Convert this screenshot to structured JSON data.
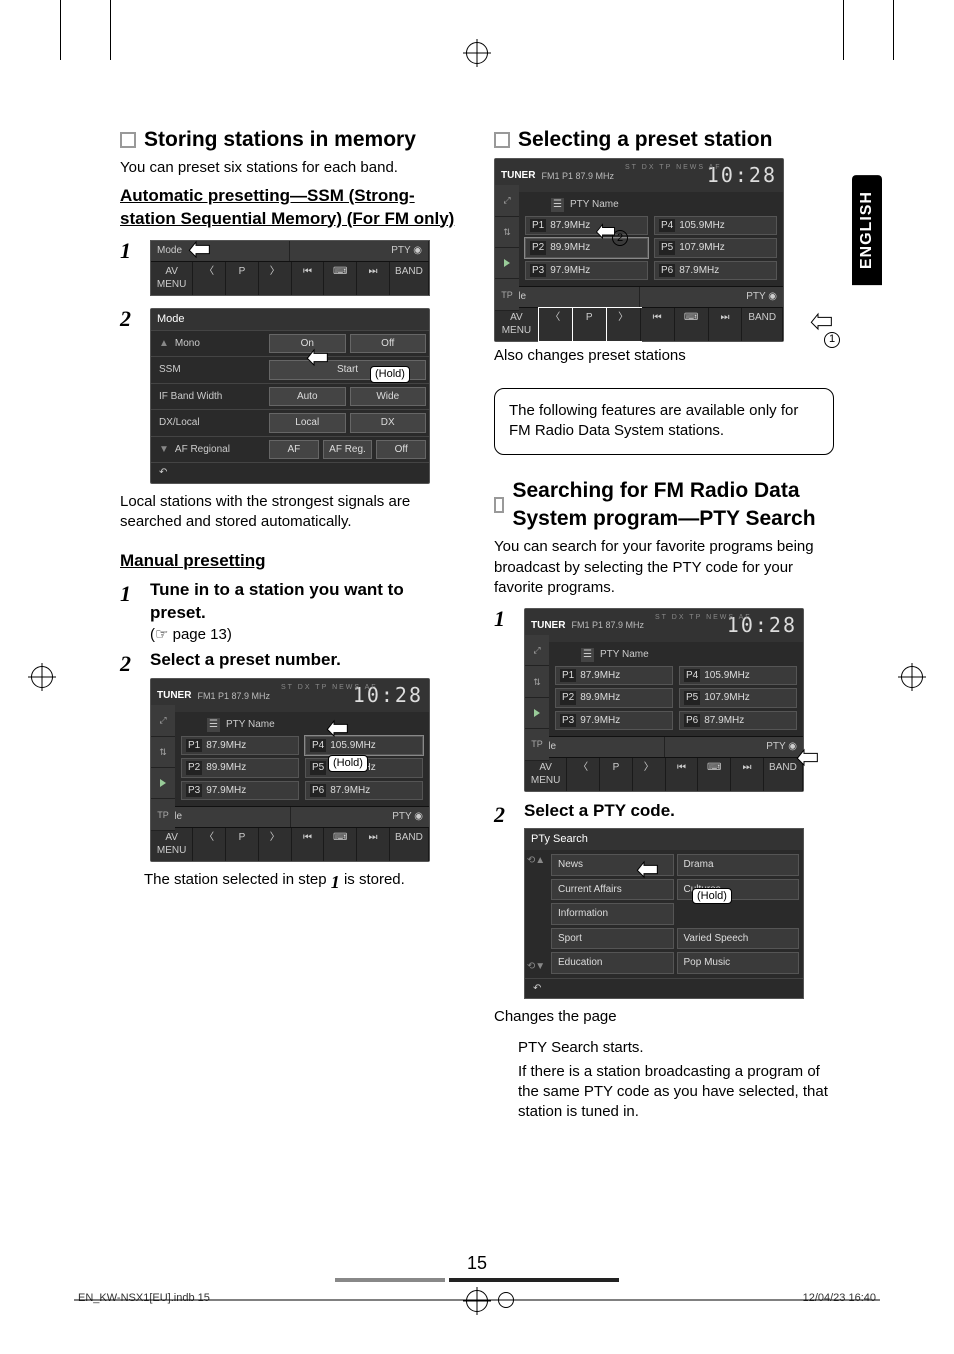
{
  "english_tab": "ENGLISH",
  "page_number": "15",
  "footer_left": "EN_KW-NSX1[EU].indb   15",
  "footer_right": "12/04/23   16:40",
  "left": {
    "h_store": "Storing stations in memory",
    "preset_line": "You can preset six stations for each band.",
    "auto_heading": "Automatic presetting—SSM (Strong-station Sequential Memory) (For FM only)",
    "step1": "1",
    "step2": "2",
    "bar_shot": {
      "mode": "Mode",
      "pty": "PTY",
      "avmenu": "AV MENU",
      "band": "BAND"
    },
    "mode_shot": {
      "title": "Mode",
      "rows": [
        {
          "label": "Mono",
          "opts": [
            "On",
            "Off"
          ]
        },
        {
          "label": "SSM",
          "opts": [
            "Start"
          ]
        },
        {
          "label": "IF Band Width",
          "opts": [
            "Auto",
            "Wide"
          ]
        },
        {
          "label": "DX/Local",
          "opts": [
            "Local",
            "DX"
          ]
        },
        {
          "label": "AF Regional",
          "opts": [
            "AF",
            "AF Reg.",
            "Off"
          ]
        }
      ],
      "hold": "(Hold)"
    },
    "after_mode": "Local stations with the strongest signals are searched and stored automatically.",
    "manual_heading": "Manual presetting",
    "m_step1_num": "1",
    "m_step1_bold": "Tune in to a station you want to preset.",
    "m_step1_ref": "(☞ page 13)",
    "m_step2_num": "2",
    "m_step2_bold": "Select a preset number.",
    "tuner_shot": {
      "title": "TUNER",
      "fm": "FM1 P1 87.9 MHz",
      "icons": "ST  DX  TP  NEWS  AF",
      "clock": "10:28",
      "ptyname": "PTY Name",
      "presets": [
        [
          "P1",
          "87.9MHz"
        ],
        [
          "P4",
          "105.9MHz"
        ],
        [
          "P2",
          "89.9MHz"
        ],
        [
          "P5",
          "107.9MHz"
        ],
        [
          "P3",
          "97.9MHz"
        ],
        [
          "P6",
          "87.9MHz"
        ]
      ],
      "mode": "Mode",
      "pty": "PTY",
      "avmenu": "AV MENU",
      "band": "BAND",
      "hold": "(Hold)"
    },
    "after_tuner_a": "The station selected in step ",
    "after_tuner_num": "1",
    "after_tuner_b": " is stored."
  },
  "right": {
    "h_select": "Selecting a preset station",
    "select_shot": {
      "title": "TUNER",
      "fm": "FM1 P1 87.9 MHz",
      "icons": "ST  DX  TP  NEWS  AF",
      "clock": "10:28",
      "ptyname": "PTY Name",
      "presets": [
        [
          "P1",
          "87.9MHz"
        ],
        [
          "P4",
          "105.9MHz"
        ],
        [
          "P2",
          "89.9MHz"
        ],
        [
          "P5",
          "107.9MHz"
        ],
        [
          "P3",
          "97.9MHz"
        ],
        [
          "P6",
          "87.9MHz"
        ]
      ],
      "mode": "Mode",
      "pty": "PTY",
      "avmenu": "AV MENU",
      "band": "BAND",
      "circ2": "2",
      "circ1": "1"
    },
    "also_changes": "Also changes preset stations",
    "boxnote": "The following features are available only for FM Radio Data System stations.",
    "h_search": "Searching for FM Radio Data System program—PTY Search",
    "search_body": "You can search for your favorite programs being broadcast by selecting the PTY code for your favorite programs.",
    "s_step1": "1",
    "tuner_shot2": {
      "title": "TUNER",
      "fm": "FM1 P1 87.9 MHz",
      "icons": "ST  DX  TP  NEWS  AF",
      "clock": "10:28",
      "ptyname": "PTY Name",
      "presets": [
        [
          "P1",
          "87.9MHz"
        ],
        [
          "P4",
          "105.9MHz"
        ],
        [
          "P2",
          "89.9MHz"
        ],
        [
          "P5",
          "107.9MHz"
        ],
        [
          "P3",
          "97.9MHz"
        ],
        [
          "P6",
          "87.9MHz"
        ]
      ],
      "mode": "Mode",
      "pty": "PTY",
      "avmenu": "AV MENU",
      "band": "BAND"
    },
    "s_step2_num": "2",
    "s_step2_bold": "Select a PTY code.",
    "pty_shot": {
      "title": "PTy Search",
      "cells": [
        "News",
        "Drama",
        "Current Affairs",
        "Cultures",
        "Information",
        "",
        "Sport",
        "Varied Speech",
        "Education",
        "Pop Music"
      ],
      "hold": "(Hold)"
    },
    "changes_page": "Changes the page",
    "pty_starts": "PTY Search starts.",
    "pty_body": "If there is a station broadcasting a program of the same PTY code as you have selected, that station is tuned in."
  }
}
